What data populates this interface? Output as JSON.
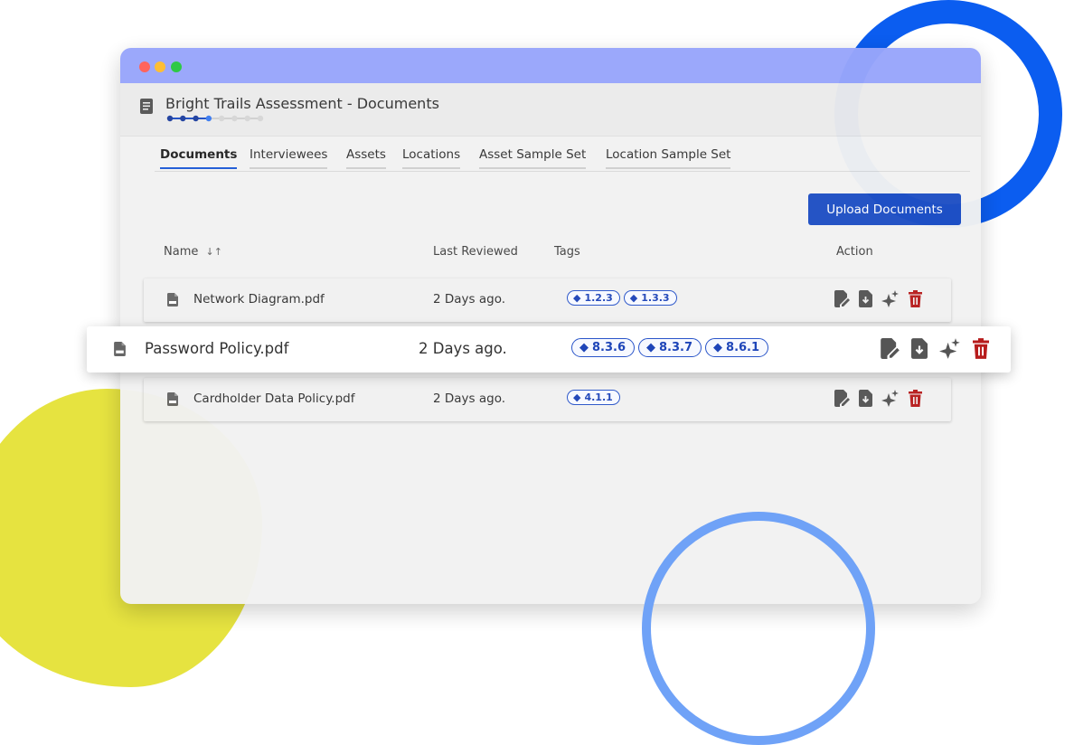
{
  "window": {
    "title": "Bright Trails Assessment - Documents"
  },
  "tabs": [
    {
      "label": "Documents",
      "active": true
    },
    {
      "label": "Interviewees",
      "active": false
    },
    {
      "label": "Assets",
      "active": false
    },
    {
      "label": "Locations",
      "active": false
    },
    {
      "label": "Asset Sample Set",
      "active": false
    },
    {
      "label": "Location Sample Set",
      "active": false
    }
  ],
  "toolbar": {
    "upload_label": "Upload Documents"
  },
  "table": {
    "columns": {
      "name": "Name",
      "name_sort_icon": "↓↑",
      "last_reviewed": "Last Reviewed",
      "tags": "Tags",
      "action": "Action"
    },
    "rows": [
      {
        "name": "Network Diagram.pdf",
        "last_reviewed": "2 Days ago.",
        "tags": [
          "1.2.3",
          "1.3.3"
        ],
        "highlighted": false
      },
      {
        "name": "Password Policy.pdf",
        "last_reviewed": "2 Days ago.",
        "tags": [
          "8.3.6",
          "8.3.7",
          "8.6.1"
        ],
        "highlighted": true
      },
      {
        "name": "Cardholder Data Policy.pdf",
        "last_reviewed": "2 Days ago.",
        "tags": [
          "4.1.1"
        ],
        "highlighted": false
      }
    ],
    "action_icons": [
      "sign-document-icon",
      "download-document-icon",
      "ai-sparkle-icon",
      "delete-trash-icon"
    ]
  },
  "stepper": {
    "total_steps": 8,
    "completed_steps": 4
  },
  "colors": {
    "titlebar": "#98a6fb",
    "accent": "#1e4fc4",
    "tag": "#2a55c9",
    "delete": "#b71c1c",
    "icon": "#555555",
    "deco_blue_ring": "#0b5df0",
    "deco_light_ring": "#6fa2f7",
    "deco_yellow_blob": "#e6e340"
  }
}
